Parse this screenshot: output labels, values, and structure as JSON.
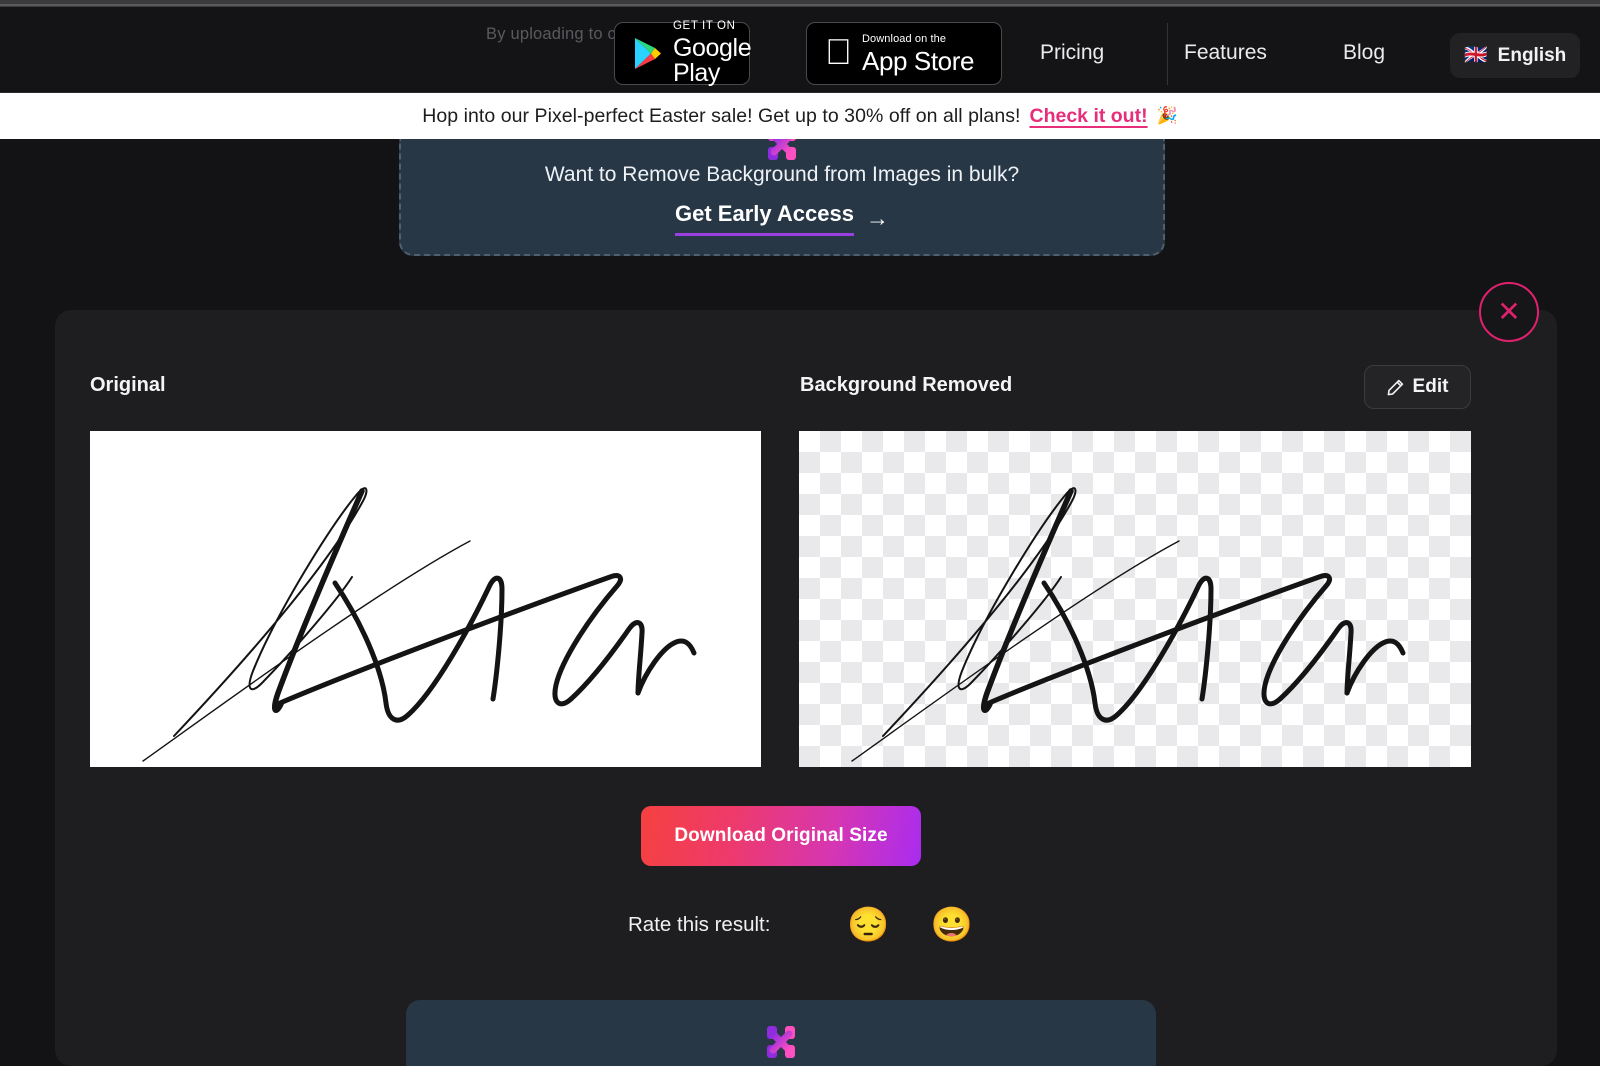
{
  "nav": {
    "faint_text": "By uploading                         to                                    cy Policy.",
    "store_badges": [
      {
        "icon": "google-play-icon",
        "top_label": "GET IT ON",
        "main_label": "Google Play"
      },
      {
        "icon": "apple-logo-icon",
        "top_label": "Download on the",
        "main_label": "App Store"
      }
    ],
    "links": [
      {
        "label": "Pricing"
      },
      {
        "label": "Features"
      },
      {
        "label": "Blog"
      }
    ],
    "language": {
      "flag": "🇬🇧",
      "label": "English",
      "icon": "uk-flag-icon"
    }
  },
  "promo": {
    "text": "Hop into our Pixel-perfect Easter sale! Get up to 30% off on all plans!",
    "cta": "Check it out!",
    "emoji": "🎉"
  },
  "bulk_card": {
    "title": "Want to Remove Background from Images in bulk?",
    "link": "Get Early Access",
    "arrow": "→"
  },
  "result": {
    "original_title": "Original",
    "removed_title": "Background Removed",
    "edit_label": "Edit",
    "close_label": "✕",
    "download_label": "Download Original Size"
  },
  "rate": {
    "label": "Rate this result:",
    "sad_emoji": "😔",
    "happy_emoji": "😀"
  },
  "colors": {
    "page_bg": "#131315",
    "panel_bg": "#1e1e21",
    "card_bg": "#273746",
    "accent_pink": "#e0216e",
    "accent_purple": "#9b3fe0",
    "promo_cta": "#e62e7b"
  }
}
